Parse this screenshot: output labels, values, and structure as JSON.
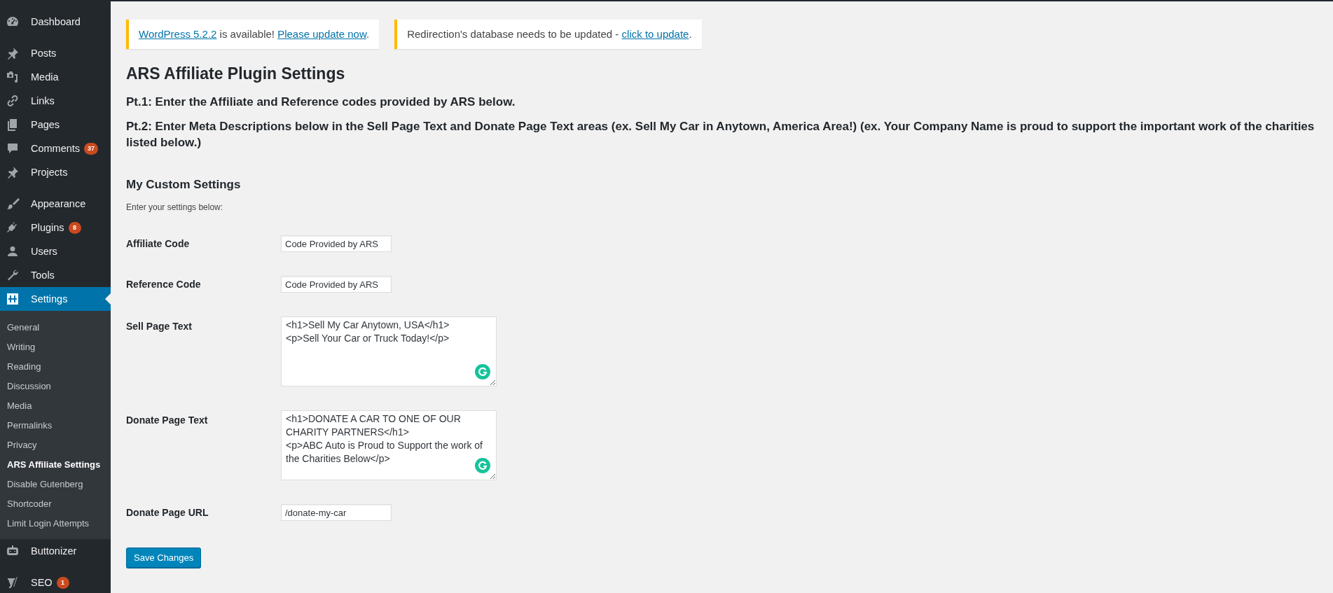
{
  "sidebar": {
    "sections": [
      {
        "items": [
          {
            "label": "Dashboard",
            "selected": false
          }
        ]
      },
      {
        "items": [
          {
            "label": "Posts",
            "selected": false
          },
          {
            "label": "Media",
            "selected": false
          },
          {
            "label": "Links",
            "selected": false
          },
          {
            "label": "Pages",
            "selected": false
          },
          {
            "label": "Comments",
            "badge": "37",
            "selected": false
          },
          {
            "label": "Projects",
            "selected": false
          }
        ]
      },
      {
        "items": [
          {
            "label": "Appearance",
            "selected": false
          },
          {
            "label": "Plugins",
            "badge": "8",
            "selected": false
          },
          {
            "label": "Users",
            "selected": false
          },
          {
            "label": "Tools",
            "selected": false
          },
          {
            "label": "Settings",
            "selected": true,
            "children": [
              {
                "label": "General",
                "selected": false
              },
              {
                "label": "Writing",
                "selected": false
              },
              {
                "label": "Reading",
                "selected": false
              },
              {
                "label": "Discussion",
                "selected": false
              },
              {
                "label": "Media",
                "selected": false
              },
              {
                "label": "Permalinks",
                "selected": false
              },
              {
                "label": "Privacy",
                "selected": false
              },
              {
                "label": "ARS Affiliate Settings",
                "selected": true
              },
              {
                "label": "Disable Gutenberg",
                "selected": false
              },
              {
                "label": "Shortcoder",
                "selected": false
              },
              {
                "label": "Limit Login Attempts",
                "selected": false
              }
            ]
          },
          {
            "label": "Buttonizer",
            "selected": false
          }
        ]
      },
      {
        "items": [
          {
            "label": "SEO",
            "badge": "1",
            "selected": false
          }
        ]
      }
    ]
  },
  "notices": [
    {
      "parts": [
        {
          "text": "WordPress 5.2.2",
          "link": true
        },
        {
          "text": " is available! ",
          "link": false
        },
        {
          "text": "Please update now",
          "link": true
        },
        {
          "text": ".",
          "link": false
        }
      ]
    },
    {
      "parts": [
        {
          "text": "Redirection's database needs to be updated - ",
          "link": false
        },
        {
          "text": "click to update",
          "link": true
        },
        {
          "text": ".",
          "link": false
        }
      ]
    }
  ],
  "title": "ARS Affiliate Plugin Settings",
  "instructions": [
    "Pt.1: Enter the Affiliate and Reference codes provided by ARS below.",
    "Pt.2: Enter Meta Descriptions below in the Sell Page Text and Donate Page Text areas (ex. Sell My Car in Anytown, America Area!) (ex. Your Company Name is proud to support the important work of the charities listed below.)"
  ],
  "section": {
    "title": "My Custom Settings",
    "description": "Enter your settings below:"
  },
  "fields": [
    {
      "kind": "text",
      "label": "Affiliate Code",
      "value": "Code Provided by ARS"
    },
    {
      "kind": "text",
      "label": "Reference Code",
      "value": "Code Provided by ARS"
    },
    {
      "kind": "textarea",
      "label": "Sell Page Text",
      "value": "<h1>Sell My Car Anytown, USA</h1>\n<p>Sell Your Car or Truck Today!</p>"
    },
    {
      "kind": "textarea",
      "label": "Donate Page Text",
      "value": "<h1>DONATE A CAR TO ONE OF OUR CHARITY PARTNERS</h1>\n<p>ABC Auto is Proud to Support the work of the Charities Below</p>"
    },
    {
      "kind": "text",
      "label": "Donate Page URL",
      "value": "/donate-my-car"
    }
  ],
  "save_button": "Save Changes"
}
